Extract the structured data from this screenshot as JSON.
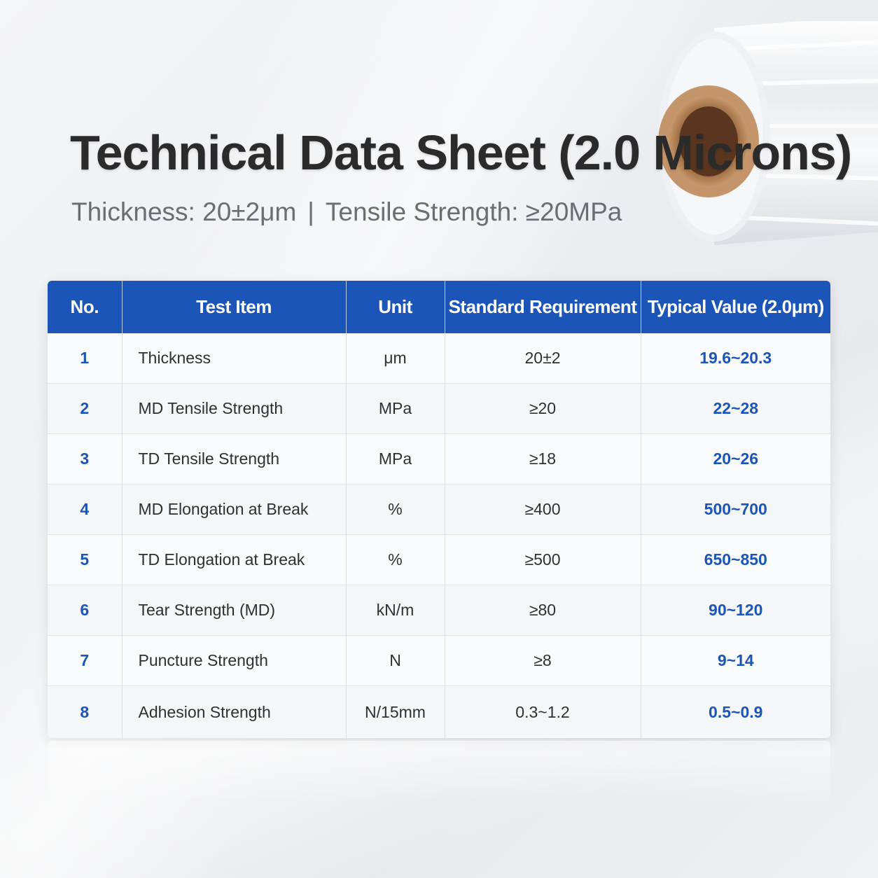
{
  "header": {
    "title": "Technical Data Sheet (2.0 Microns)",
    "subtitle_left": "Thickness: 20±2μm",
    "subtitle_sep": "|",
    "subtitle_right": "Tensile Strength: ≥20MPa"
  },
  "table": {
    "headers": [
      "No.",
      "Test Item",
      "Unit",
      "Standard Requirement",
      "Typical Value (2.0μm)"
    ],
    "rows": [
      {
        "no": "1",
        "item": "Thickness",
        "unit": "μm",
        "standard": "20±2",
        "typical": "19.6~20.3"
      },
      {
        "no": "2",
        "item": "MD Tensile Strength",
        "unit": "MPa",
        "standard": "≥20",
        "typical": "22~28"
      },
      {
        "no": "3",
        "item": "TD Tensile Strength",
        "unit": "MPa",
        "standard": "≥18",
        "typical": "20~26"
      },
      {
        "no": "4",
        "item": "MD Elongation at Break",
        "unit": "%",
        "standard": "≥400",
        "typical": "500~700"
      },
      {
        "no": "5",
        "item": "TD Elongation at Break",
        "unit": "%",
        "standard": "≥500",
        "typical": "650~850"
      },
      {
        "no": "6",
        "item": "Tear Strength (MD)",
        "unit": "kN/m",
        "standard": "≥80",
        "typical": "90~120"
      },
      {
        "no": "7",
        "item": "Puncture Strength",
        "unit": "N",
        "standard": "≥8",
        "typical": "9~14"
      },
      {
        "no": "8",
        "item": "Adhesion Strength",
        "unit": "N/15mm",
        "standard": "0.3~1.2",
        "typical": "0.5~0.9"
      }
    ]
  },
  "colors": {
    "accent": "#1c55b8",
    "title": "#2b2b2b",
    "subtitle": "#6a6d72"
  },
  "icons": {
    "hero": "film-roll-icon"
  }
}
